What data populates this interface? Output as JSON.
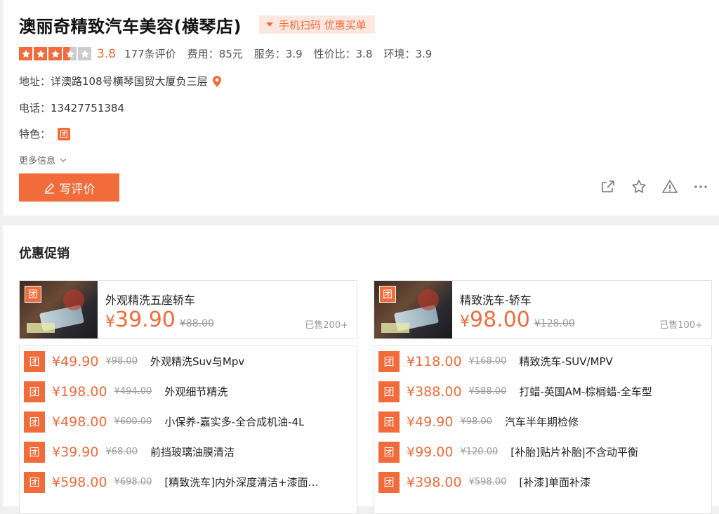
{
  "shop": {
    "name": "澳丽奇精致汽车美容(横琴店)",
    "scan_pay_label": "手机扫码 优惠买单",
    "rating": {
      "stars": 3.5,
      "score": "3.8",
      "reviews": "177条评价",
      "cost": "费用：85元",
      "service": "服务：3.9",
      "value": "性价比：3.8",
      "environment": "环境：3.9"
    },
    "address_label": "地址：",
    "address": "详澳路108号横琴国贸大厦负三层",
    "phone_label": "电话：",
    "phone": "13427751384",
    "features_label": "特色：",
    "feature_badge": "团",
    "more_info": "更多信息",
    "write_review": "写评价"
  },
  "promo": {
    "title": "优惠促销",
    "badge": "团",
    "featured": [
      {
        "name": "外观精洗五座轿车",
        "yen": "¥",
        "price": "39.90",
        "orig": "¥88.00",
        "sold": "已售200+"
      },
      {
        "name": "精致洗车-轿车",
        "yen": "¥",
        "price": "98.00",
        "orig": "¥128.00",
        "sold": "已售100+"
      }
    ],
    "left_deals": [
      {
        "price": "¥49.90",
        "orig": "¥98.00",
        "name": "外观精洗Suv与Mpv"
      },
      {
        "price": "¥198.00",
        "orig": "¥494.00",
        "name": "外观细节精洗"
      },
      {
        "price": "¥498.00",
        "orig": "¥600.00",
        "name": "小保养-嘉实多-全合成机油-4L"
      },
      {
        "price": "¥39.90",
        "orig": "¥68.00",
        "name": "前挡玻璃油膜清洁"
      },
      {
        "price": "¥598.00",
        "orig": "¥698.00",
        "name": "[精致洗车]内外深度清洁+漆面…"
      }
    ],
    "right_deals": [
      {
        "price": "¥118.00",
        "orig": "¥168.00",
        "name": "精致洗车-SUV/MPV"
      },
      {
        "price": "¥388.00",
        "orig": "¥588.00",
        "name": "打蜡-英国AM-棕榈蜡-全车型"
      },
      {
        "price": "¥49.90",
        "orig": "¥98.00",
        "name": "汽车半年期检修"
      },
      {
        "price": "¥99.00",
        "orig": "¥120.00",
        "name": "[补胎]贴片补胎|不含动平衡"
      },
      {
        "price": "¥398.00",
        "orig": "¥598.00",
        "name": "[补漆]单面补漆"
      }
    ]
  },
  "colors": {
    "accent": "#f26b3a",
    "badge_bg": "#fde8e1"
  },
  "icons": [
    "star-icon",
    "location-pin-icon",
    "chevron-down-icon",
    "pen-icon",
    "share-icon",
    "favorite-star-icon",
    "warning-icon",
    "more-icon"
  ]
}
